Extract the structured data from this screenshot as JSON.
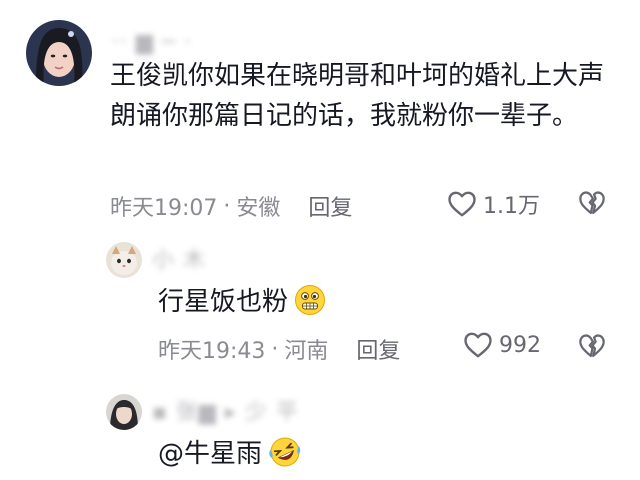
{
  "comments": [
    {
      "username": "·· ▆ ─ ·",
      "text": "王俊凯你如果在晓明哥和叶坷的婚礼上大声朗诵你那篇日记的话，我就粉你一辈子。",
      "time": "昨天19:07",
      "separator": "·",
      "location": "安徽",
      "reply_label": "回复",
      "likes": "1.1万",
      "emoji": ""
    },
    {
      "username": "小 木",
      "text": "行星饭也粉",
      "time": "昨天19:43",
      "separator": "·",
      "location": "河南",
      "reply_label": "回复",
      "likes": "992",
      "emoji": "grimace-emoji"
    },
    {
      "username": "▪ 张▆ ▸ 少 平",
      "text": "@牛星雨",
      "emoji": "rolling-laughing-emoji"
    }
  ],
  "colors": {
    "text": "#161823",
    "meta": "#8a8b91",
    "icon": "#666770"
  },
  "icons": [
    "heart-icon",
    "broken-heart-icon"
  ]
}
